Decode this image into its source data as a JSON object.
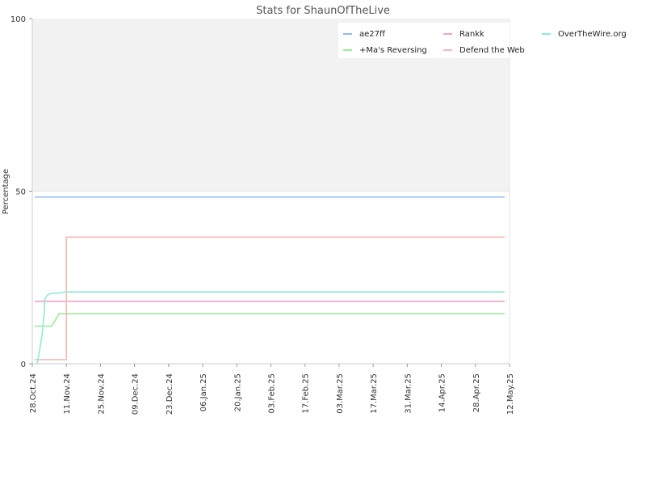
{
  "chart_data": {
    "type": "line",
    "title": "Stats for ShaunOfTheLive",
    "ylabel": "Percentage",
    "xlabel": "",
    "ylim": [
      0,
      100
    ],
    "y_ticks": [
      "0",
      "50",
      "100"
    ],
    "x_ticks": [
      "28.Oct.24",
      "11.Nov.24",
      "25.Nov.24",
      "09.Dec.24",
      "23.Dec.24",
      "06.Jan.25",
      "20.Jan.25",
      "03.Feb.25",
      "17.Feb.25",
      "03.Mar.25",
      "17.Mar.25",
      "31.Mar.25",
      "14.Apr.25",
      "28.Apr.25",
      "12.May.25"
    ],
    "x_tick_dates": [
      "2024-10-28",
      "2024-11-11",
      "2024-11-25",
      "2024-12-09",
      "2024-12-23",
      "2025-01-06",
      "2025-01-20",
      "2025-02-03",
      "2025-02-17",
      "2025-03-03",
      "2025-03-17",
      "2025-03-31",
      "2025-04-14",
      "2025-04-28",
      "2025-05-12"
    ],
    "xlim": [
      "2024-10-28",
      "2025-05-12"
    ],
    "grid": false,
    "legend_position": "top-right",
    "series": [
      {
        "name": "ae27ff",
        "color": "#8fbcf4",
        "points": [
          [
            "2024-10-29",
            48.3
          ],
          [
            "2025-05-10",
            48.3
          ]
        ]
      },
      {
        "name": "+Ma's Reversing",
        "color": "#9aee9a",
        "points": [
          [
            "2024-10-29",
            10.9
          ],
          [
            "2024-11-05",
            10.9
          ],
          [
            "2024-11-08",
            14.5
          ],
          [
            "2025-05-10",
            14.5
          ]
        ]
      },
      {
        "name": "Rankk",
        "color": "#e8a5c9",
        "points": [
          [
            "2024-10-29",
            17.9
          ],
          [
            "2024-10-30",
            18.1
          ],
          [
            "2025-05-10",
            18.1
          ]
        ]
      },
      {
        "name": "Defend the Web",
        "color": "#f4baba",
        "points": [
          [
            "2024-10-29",
            1.2
          ],
          [
            "2024-11-11",
            1.2
          ],
          [
            "2024-11-11",
            36.7
          ],
          [
            "2025-05-10",
            36.7
          ]
        ]
      },
      {
        "name": "OverTheWire.org",
        "color": "#8eead8",
        "points": [
          [
            "2024-10-30",
            0
          ],
          [
            "2024-10-31",
            3.8
          ],
          [
            "2024-11-01",
            8.3
          ],
          [
            "2024-11-02",
            15.5
          ],
          [
            "2024-11-02",
            18.5
          ],
          [
            "2024-11-03",
            19.7
          ],
          [
            "2024-11-04",
            20.2
          ],
          [
            "2024-11-05",
            20.4
          ],
          [
            "2024-11-08",
            20.5
          ],
          [
            "2024-11-11",
            20.8
          ],
          [
            "2025-05-10",
            20.8
          ]
        ]
      }
    ]
  }
}
